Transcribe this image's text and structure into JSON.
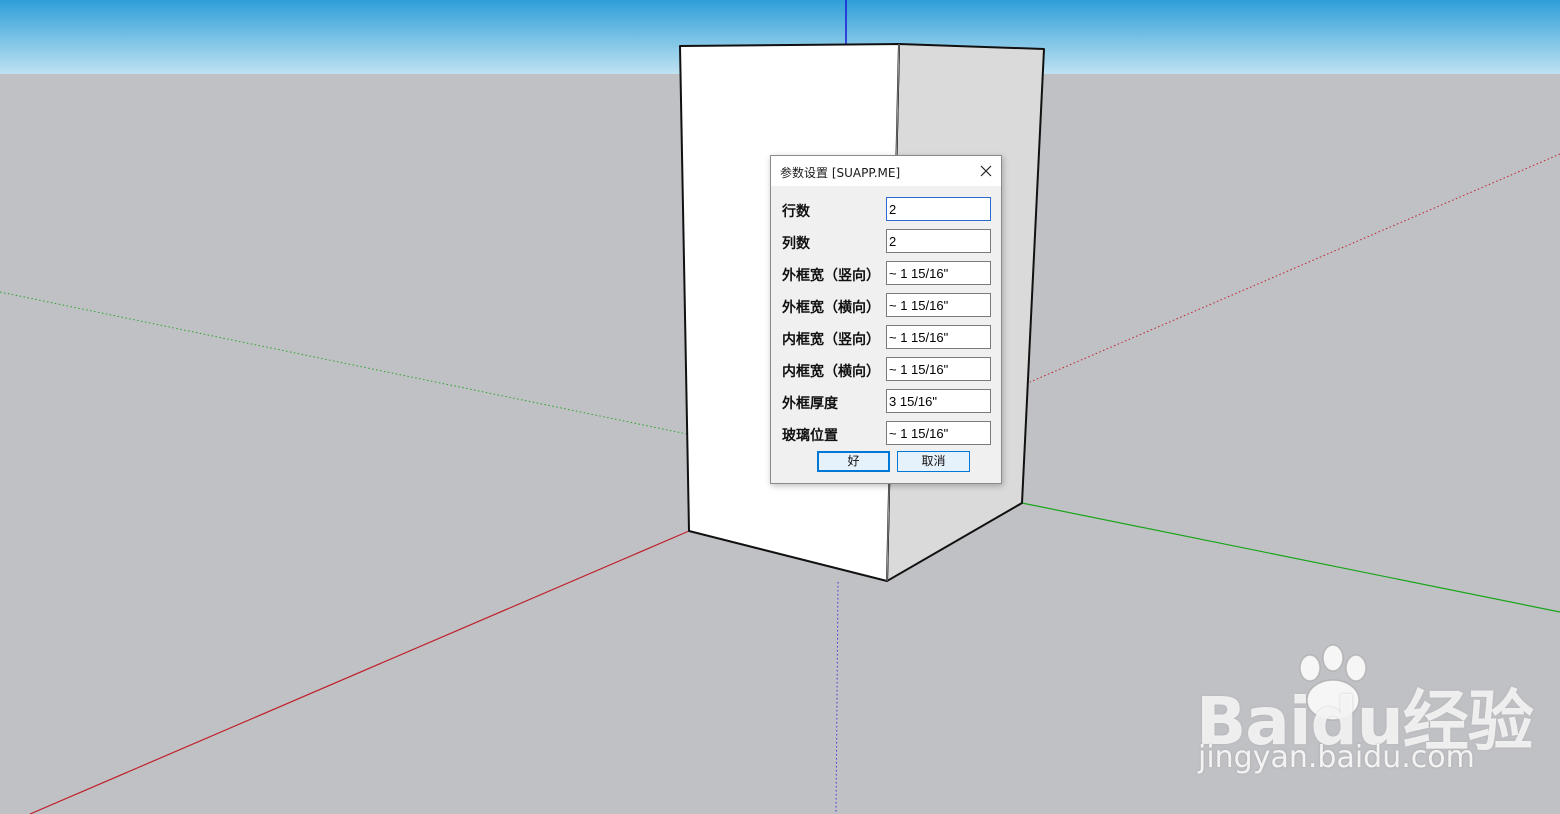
{
  "dialog": {
    "title": "参数设置 [SUAPP.ME]",
    "close_icon": "close-icon",
    "fields": [
      {
        "label": "行数",
        "value": "2"
      },
      {
        "label": "列数",
        "value": "2"
      },
      {
        "label": "外框宽（竖向）",
        "value": "~ 1 15/16\""
      },
      {
        "label": "外框宽（横向）",
        "value": "~ 1 15/16\""
      },
      {
        "label": "内框宽（竖向）",
        "value": "~ 1 15/16\""
      },
      {
        "label": "内框宽（横向）",
        "value": "~ 1 15/16\""
      },
      {
        "label": "外框厚度",
        "value": "3 15/16\""
      },
      {
        "label": "玻璃位置",
        "value": "~ 1 15/16\""
      }
    ],
    "ok_label": "好",
    "cancel_label": "取消"
  },
  "watermark": {
    "brand": "Baidu经验",
    "url": "jingyan.baidu.com"
  },
  "colors": {
    "sky_top": "#34a4dc",
    "sky_bottom": "#b4dcf0",
    "ground": "#c0c1c5",
    "axis_red": "#c0202a",
    "axis_green": "#1aa41a",
    "axis_blue": "#1a1ad8",
    "face_light": "#ffffff",
    "face_shade": "#dcdcdc"
  }
}
